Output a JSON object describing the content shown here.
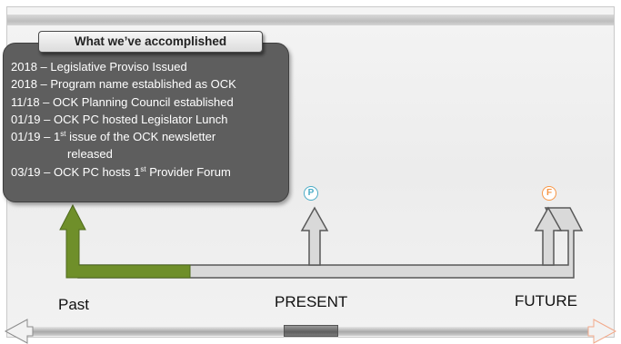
{
  "panel": {
    "title": "What we’ve accomplished",
    "items": [
      {
        "text": "2018 – Legislative Proviso Issued"
      },
      {
        "text": "2018 – Program name established as OCK"
      },
      {
        "text": "11/18 – OCK Planning Council established"
      },
      {
        "text": "01/19 – OCK PC hosted Legislator Lunch"
      },
      {
        "pre": "01/19 – 1",
        "sup": "st",
        "post": " issue of the OCK newsletter"
      },
      {
        "text": "released",
        "indent": true
      },
      {
        "pre": "03/19 – OCK PC hosts 1",
        "sup": "st",
        "post": " Provider Forum"
      }
    ]
  },
  "timeline": {
    "past_label": "Past",
    "present_label": "PRESENT",
    "future_label": "FUTURE",
    "present_marker": "P",
    "future_marker": "F",
    "past_progress_fraction": 0.31
  },
  "colors": {
    "past_arrow": "#6f8f2a",
    "arrow_outline": "#595959",
    "arrow_fill": "#d9d9d9",
    "panel_bg": "#5e5e5e",
    "present_marker": "#4bacc6",
    "future_marker": "#f79646"
  },
  "icons": {
    "present_marker": "circle-p-icon",
    "future_marker": "circle-f-icon",
    "scroll_left": "arrow-left-icon",
    "scroll_right": "arrow-right-icon"
  }
}
